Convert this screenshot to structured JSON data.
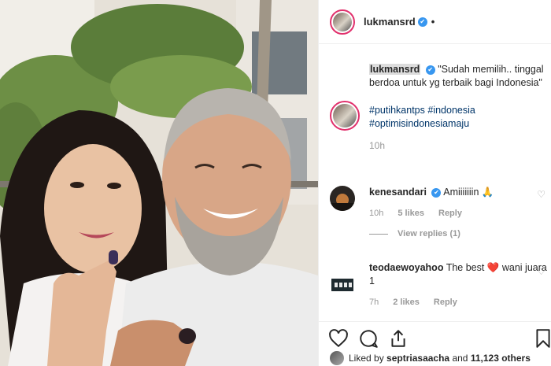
{
  "post": {
    "username": "lukmansrd",
    "verified_mark": "✔",
    "more_dot": "•"
  },
  "caption": {
    "username": "lukmansrd",
    "text": "\"Sudah memilih.. tinggal berdoa untuk yg terbaik bagi Indonesia\"",
    "hashtags": [
      "#putihkantps",
      "#indonesia",
      "#optimisindonesiamaju"
    ],
    "time": "10h"
  },
  "comments": [
    {
      "username": "kenesandari",
      "text": "Amiiiiiiin 🙏",
      "time": "10h",
      "likes": "5 likes",
      "reply": "Reply",
      "view_replies": "View replies (1)"
    },
    {
      "username": "teodaewoyahoo",
      "text": "The best ❤️ wani juara 1",
      "time": "7h",
      "likes": "2 likes",
      "reply": "Reply"
    }
  ],
  "likes": {
    "prefix": "Liked by",
    "user": "septriasaacha",
    "and": "and",
    "count": "11,123 others"
  },
  "icons": {
    "like": "heart-icon",
    "comment": "comment-icon",
    "share": "share-icon",
    "save": "bookmark-icon"
  },
  "colors": {
    "verified": "#3897f0",
    "hashtag": "#003569",
    "muted": "#999999",
    "avatar_ring": "#e1306c"
  }
}
